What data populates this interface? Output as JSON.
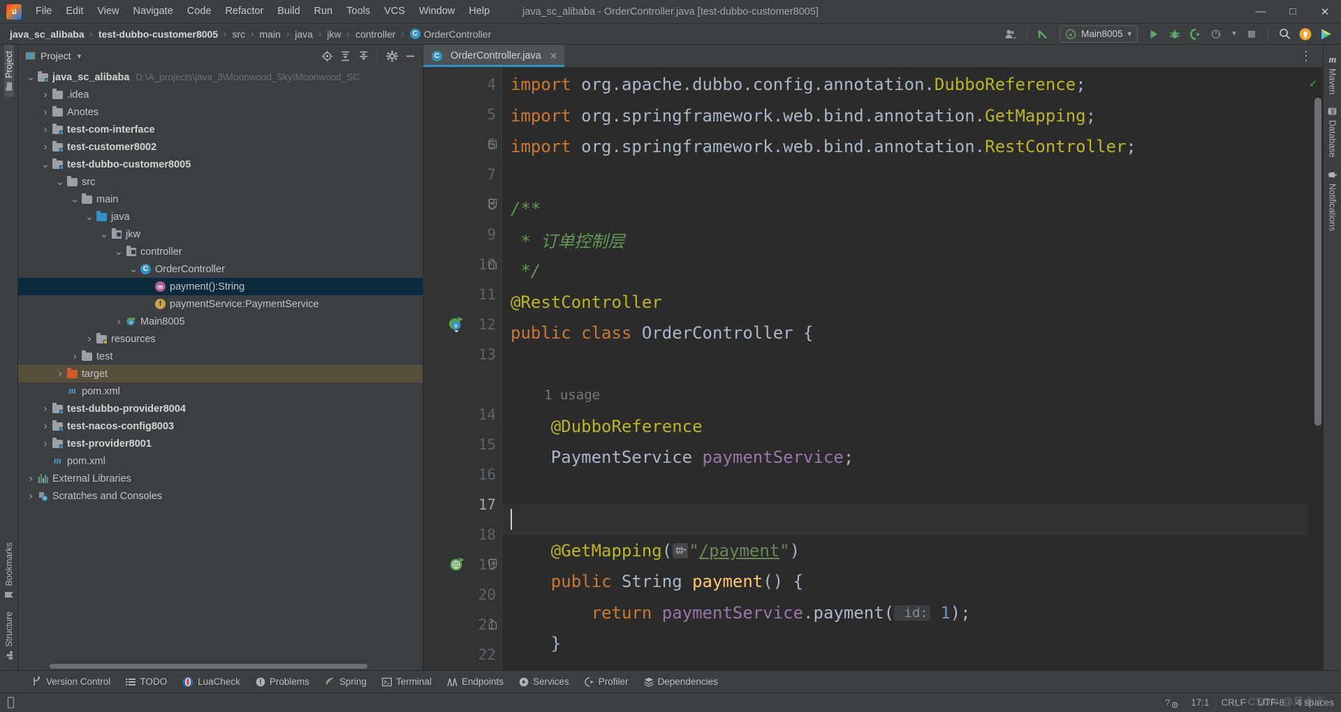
{
  "window": {
    "title": "java_sc_alibaba - OrderController.java [test-dubbo-customer8005]",
    "logo_text": "IJ",
    "minimize": "—",
    "maximize": "□",
    "close": "✕"
  },
  "menubar": {
    "items": [
      {
        "label": "File"
      },
      {
        "label": "Edit"
      },
      {
        "label": "View"
      },
      {
        "label": "Navigate"
      },
      {
        "label": "Code"
      },
      {
        "label": "Refactor"
      },
      {
        "label": "Build"
      },
      {
        "label": "Run"
      },
      {
        "label": "Tools"
      },
      {
        "label": "VCS"
      },
      {
        "label": "Window"
      },
      {
        "label": "Help"
      }
    ]
  },
  "navbar": {
    "crumbs": [
      {
        "label": "java_sc_alibaba",
        "bold": true
      },
      {
        "label": "test-dubbo-customer8005",
        "bold": true
      },
      {
        "label": "src",
        "bold": false
      },
      {
        "label": "main",
        "bold": false
      },
      {
        "label": "java",
        "bold": false
      },
      {
        "label": "jkw",
        "bold": false
      },
      {
        "label": "controller",
        "bold": false
      },
      {
        "label": "OrderController",
        "bold": false,
        "icon": "class-icon",
        "icon_letter": "C"
      }
    ],
    "separator": "›",
    "run_config": {
      "label": "Main8005",
      "dropdown": "▾"
    },
    "icons": [
      "account-icon",
      "dropdown-icon",
      "update-project-icon",
      "run-icon",
      "debug-icon",
      "run-with-coverage-icon",
      "profiler-icon",
      "stop-icon",
      "search-icon",
      "ide-update-icon",
      "feedback-icon"
    ]
  },
  "left_strip": {
    "top": [
      {
        "label": "Project",
        "icon": "project-folder-icon",
        "active": true
      }
    ],
    "bottom": [
      {
        "label": "Bookmarks",
        "icon": "bookmark-icon"
      },
      {
        "label": "Structure",
        "icon": "structure-icon"
      }
    ]
  },
  "right_strip": {
    "items": [
      {
        "label": "Maven",
        "icon": "maven-icon"
      },
      {
        "label": "Database",
        "icon": "database-icon"
      },
      {
        "label": "Notifications",
        "icon": "bell-icon"
      }
    ]
  },
  "project_pane": {
    "title": "Project",
    "dropdown": "▾",
    "tools": [
      "locate-icon",
      "expand-all-icon",
      "collapse-all-icon",
      "settings-icon",
      "hide-icon"
    ],
    "tree": [
      {
        "indent": 0,
        "arrow": "down",
        "icon": "module-folder-icon",
        "label": "java_sc_alibaba",
        "bold": true,
        "sub": "D:\\A_projects\\java_3\\Moonwood_Sky\\Moonwood_SC"
      },
      {
        "indent": 1,
        "arrow": "right",
        "icon": "folder-icon",
        "label": ".idea",
        "bold": false
      },
      {
        "indent": 1,
        "arrow": "right",
        "icon": "folder-icon",
        "label": "Anotes",
        "bold": false
      },
      {
        "indent": 1,
        "arrow": "right",
        "icon": "module-folder-icon",
        "label": "test-com-interface",
        "bold": true
      },
      {
        "indent": 1,
        "arrow": "right",
        "icon": "module-folder-icon",
        "label": "test-customer8002",
        "bold": true
      },
      {
        "indent": 1,
        "arrow": "down",
        "icon": "module-folder-icon",
        "label": "test-dubbo-customer8005",
        "bold": true
      },
      {
        "indent": 2,
        "arrow": "down",
        "icon": "folder-icon",
        "label": "src",
        "bold": false
      },
      {
        "indent": 3,
        "arrow": "down",
        "icon": "folder-icon",
        "label": "main",
        "bold": false
      },
      {
        "indent": 4,
        "arrow": "down",
        "icon": "source-folder-icon",
        "label": "java",
        "bold": false
      },
      {
        "indent": 5,
        "arrow": "down",
        "icon": "package-icon",
        "label": "jkw",
        "bold": false
      },
      {
        "indent": 6,
        "arrow": "down",
        "icon": "package-icon",
        "label": "controller",
        "bold": false
      },
      {
        "indent": 7,
        "arrow": "down",
        "icon": "class-icon",
        "label": "OrderController",
        "bold": false
      },
      {
        "indent": 8,
        "arrow": "none",
        "icon": "method-icon",
        "label": "payment():String",
        "bold": false,
        "selected": true
      },
      {
        "indent": 8,
        "arrow": "none",
        "icon": "field-icon",
        "label": "paymentService:PaymentService",
        "bold": false
      },
      {
        "indent": 6,
        "arrow": "right",
        "icon": "spring-class-icon",
        "label": "Main8005",
        "bold": false
      },
      {
        "indent": 4,
        "arrow": "right",
        "icon": "resource-folder-icon",
        "label": "resources",
        "bold": false
      },
      {
        "indent": 3,
        "arrow": "right",
        "icon": "folder-icon",
        "label": "test",
        "bold": false
      },
      {
        "indent": 2,
        "arrow": "right",
        "icon": "excluded-folder-icon",
        "label": "target",
        "bold": false,
        "highlighted": true
      },
      {
        "indent": 2,
        "arrow": "none",
        "icon": "maven-file-icon",
        "label": "pom.xml",
        "bold": false
      },
      {
        "indent": 1,
        "arrow": "right",
        "icon": "module-folder-icon",
        "label": "test-dubbo-provider8004",
        "bold": true
      },
      {
        "indent": 1,
        "arrow": "right",
        "icon": "module-folder-icon",
        "label": "test-nacos-config8003",
        "bold": true
      },
      {
        "indent": 1,
        "arrow": "right",
        "icon": "module-folder-icon",
        "label": "test-provider8001",
        "bold": true
      },
      {
        "indent": 1,
        "arrow": "none",
        "icon": "maven-file-icon",
        "label": "pom.xml",
        "bold": false
      },
      {
        "indent": 0,
        "arrow": "right",
        "icon": "external-libraries-icon",
        "label": "External Libraries",
        "bold": false
      },
      {
        "indent": 0,
        "arrow": "right",
        "icon": "scratches-icon",
        "label": "Scratches and Consoles",
        "bold": false
      }
    ]
  },
  "editor": {
    "tabs": [
      {
        "label": "OrderController.java",
        "icon": "class-icon",
        "icon_letter": "C",
        "close": "✕",
        "active": true
      }
    ],
    "options_icon": "⋮",
    "first_visible_line": 4,
    "current_line": 17,
    "lines": [
      {
        "n": "4",
        "fold": "",
        "gutter_icon": "",
        "tokens": [
          {
            "t": "import ",
            "c": "kw"
          },
          {
            "t": "org.apache.dubbo.config.annotation.",
            "c": "pl"
          },
          {
            "t": "DubboReference",
            "c": "ann"
          },
          {
            "t": ";",
            "c": "pl"
          }
        ]
      },
      {
        "n": "5",
        "fold": "",
        "gutter_icon": "",
        "tokens": [
          {
            "t": "import ",
            "c": "kw"
          },
          {
            "t": "org.springframework.web.bind.annotation.",
            "c": "pl"
          },
          {
            "t": "GetMapping",
            "c": "ann"
          },
          {
            "t": ";",
            "c": "pl"
          }
        ]
      },
      {
        "n": "6",
        "fold": "minus",
        "gutter_icon": "",
        "tokens": [
          {
            "t": "import ",
            "c": "kw"
          },
          {
            "t": "org.springframework.web.bind.annotation.",
            "c": "pl"
          },
          {
            "t": "RestController",
            "c": "ann"
          },
          {
            "t": ";",
            "c": "pl"
          }
        ]
      },
      {
        "n": "7",
        "fold": "",
        "gutter_icon": "",
        "tokens": []
      },
      {
        "n": "8",
        "fold": "start",
        "gutter_icon": "",
        "tokens": [
          {
            "t": "/**",
            "c": "cmt"
          }
        ]
      },
      {
        "n": "9",
        "fold": "",
        "gutter_icon": "",
        "tokens": [
          {
            "t": " * 订单控制层",
            "c": "cmt"
          }
        ]
      },
      {
        "n": "10",
        "fold": "end",
        "gutter_icon": "",
        "tokens": [
          {
            "t": " */",
            "c": "cmt"
          }
        ]
      },
      {
        "n": "11",
        "fold": "",
        "gutter_icon": "",
        "tokens": [
          {
            "t": "@RestController",
            "c": "ann"
          }
        ]
      },
      {
        "n": "12",
        "fold": "",
        "gutter_icon": "spring-bean-icon",
        "tokens": [
          {
            "t": "public ",
            "c": "kw"
          },
          {
            "t": "class ",
            "c": "kw"
          },
          {
            "t": "OrderController ",
            "c": "cls"
          },
          {
            "t": "{",
            "c": "pl"
          }
        ]
      },
      {
        "n": "13",
        "fold": "",
        "gutter_icon": "",
        "tokens": []
      },
      {
        "n": "",
        "fold": "",
        "gutter_icon": "",
        "usage_hint": "1 usage",
        "tokens": []
      },
      {
        "n": "14",
        "fold": "",
        "gutter_icon": "",
        "tokens": [
          {
            "t": "    @DubboReference",
            "c": "ann"
          }
        ]
      },
      {
        "n": "15",
        "fold": "",
        "gutter_icon": "",
        "tokens": [
          {
            "t": "    PaymentService ",
            "c": "cls"
          },
          {
            "t": "paymentService",
            "c": "fieldv"
          },
          {
            "t": ";",
            "c": "pl"
          }
        ]
      },
      {
        "n": "16",
        "fold": "",
        "gutter_icon": "",
        "tokens": []
      },
      {
        "n": "17",
        "fold": "",
        "gutter_icon": "",
        "caret": true,
        "current": true,
        "tokens": []
      },
      {
        "n": "18",
        "fold": "",
        "gutter_icon": "",
        "tokens": [
          {
            "t": "    @GetMapping",
            "c": "ann"
          },
          {
            "t": "(",
            "c": "pl"
          },
          {
            "t": "__WEBICON__",
            "c": "inlay"
          },
          {
            "t": "\"",
            "c": "str"
          },
          {
            "t": "/payment",
            "c": "strlink"
          },
          {
            "t": "\"",
            "c": "str"
          },
          {
            "t": ")",
            "c": "pl"
          }
        ]
      },
      {
        "n": "19",
        "fold": "start",
        "gutter_icon": "spring-endpoint-icon",
        "tokens": [
          {
            "t": "    public ",
            "c": "kw"
          },
          {
            "t": "String ",
            "c": "cls"
          },
          {
            "t": "payment",
            "c": "meth"
          },
          {
            "t": "() {",
            "c": "pl"
          }
        ]
      },
      {
        "n": "20",
        "fold": "",
        "gutter_icon": "",
        "tokens": [
          {
            "t": "        return ",
            "c": "kw"
          },
          {
            "t": "paymentService",
            "c": "fieldv"
          },
          {
            "t": ".",
            "c": "pl"
          },
          {
            "t": "payment",
            "c": "pl"
          },
          {
            "t": "(",
            "c": "pl"
          },
          {
            "t": " id:",
            "c": "paramhint"
          },
          {
            "t": " ",
            "c": "pl"
          },
          {
            "t": "1",
            "c": "num"
          },
          {
            "t": ");",
            "c": "pl"
          }
        ]
      },
      {
        "n": "21",
        "fold": "end",
        "gutter_icon": "",
        "tokens": [
          {
            "t": "    }",
            "c": "pl"
          }
        ]
      },
      {
        "n": "22",
        "fold": "",
        "gutter_icon": "",
        "tokens": []
      }
    ]
  },
  "bottom_bar": {
    "tabs": [
      {
        "label": "Version Control",
        "icon": "branch-icon"
      },
      {
        "label": "TODO",
        "icon": "todo-icon"
      },
      {
        "label": "LuaCheck",
        "icon": "luacheck-icon"
      },
      {
        "label": "Problems",
        "icon": "problems-icon"
      },
      {
        "label": "Spring",
        "icon": "spring-leaf-icon"
      },
      {
        "label": "Terminal",
        "icon": "terminal-icon"
      },
      {
        "label": "Endpoints",
        "icon": "endpoints-icon"
      },
      {
        "label": "Services",
        "icon": "services-icon"
      },
      {
        "label": "Profiler",
        "icon": "profiler-icon"
      },
      {
        "label": "Dependencies",
        "icon": "dependencies-icon"
      }
    ]
  },
  "status_bar": {
    "left_icon": "memory-indicator-icon",
    "right_items": [
      {
        "label": "17:1",
        "name": "caret-position"
      },
      {
        "label": "CRLF",
        "name": "line-separator"
      },
      {
        "label": "UTF-8",
        "name": "file-encoding"
      },
      {
        "label": "4 spaces",
        "name": "indent-setting"
      }
    ],
    "watermark": "CSDN @月木⑧",
    "inspection_icon": "inspection-widget-icon"
  },
  "colors": {
    "accent": "#3592c4",
    "editor_bg": "#2b2b2b",
    "panel_bg": "#3c3f41",
    "gutter_bg": "#313335",
    "selection": "#0d293e",
    "keyword": "#cc7832",
    "annotation": "#bbb529",
    "comment": "#629755",
    "string": "#6a8759",
    "field": "#9876aa",
    "method": "#ffc66d",
    "number": "#6897bb",
    "plain": "#a9b7c6"
  }
}
